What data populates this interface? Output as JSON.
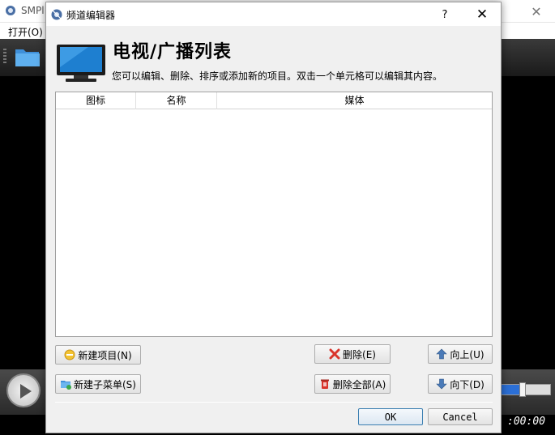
{
  "background_app": {
    "title": "SMPl",
    "menu_open": "打开(O)",
    "close_glyph": "✕",
    "time": ":00:00"
  },
  "dialog": {
    "title": "频道编辑器",
    "help_glyph": "?",
    "close_glyph": "✕"
  },
  "header": {
    "title": "电视/广播列表",
    "description": "您可以编辑、删除、排序或添加新的项目。双击一个单元格可以编辑其内容。"
  },
  "table": {
    "columns": [
      "图标",
      "名称",
      "媒体"
    ],
    "rows": []
  },
  "buttons": {
    "new_item": "新建项目(N)",
    "new_submenu": "新建子菜单(S)",
    "delete": "删除(E)",
    "delete_all": "删除全部(A)",
    "move_up": "向上(U)",
    "move_down": "向下(D)",
    "ok": "OK",
    "cancel": "Cancel"
  },
  "colors": {
    "accent_blue": "#2b6fd6",
    "delete_red": "#d9342b"
  }
}
